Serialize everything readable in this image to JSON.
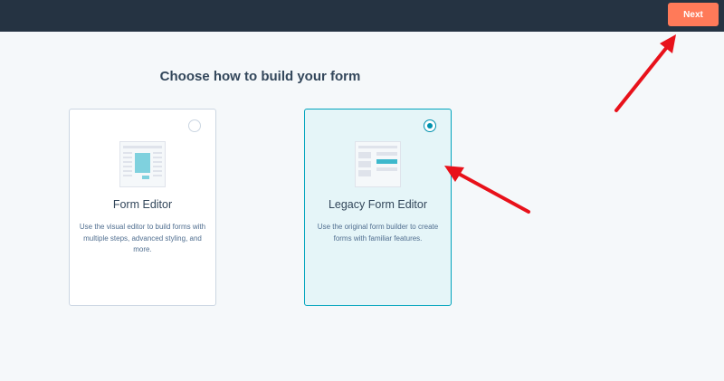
{
  "header": {
    "next_label": "Next"
  },
  "main": {
    "title": "Choose how to build your form",
    "options": [
      {
        "title": "Form Editor",
        "description": "Use the visual editor to build forms with multiple steps, advanced styling, and more.",
        "selected": false,
        "icon": "form-editor-illustration-icon"
      },
      {
        "title": "Legacy Form Editor",
        "description": "Use the original form builder to create forms with familiar features.",
        "selected": true,
        "icon": "legacy-form-illustration-icon"
      }
    ]
  },
  "colors": {
    "topbar": "#253342",
    "accent": "#ff7a59",
    "selected_border": "#00a4bd",
    "selected_bg": "#e5f5f8",
    "annotation_arrow": "#e8111a"
  }
}
